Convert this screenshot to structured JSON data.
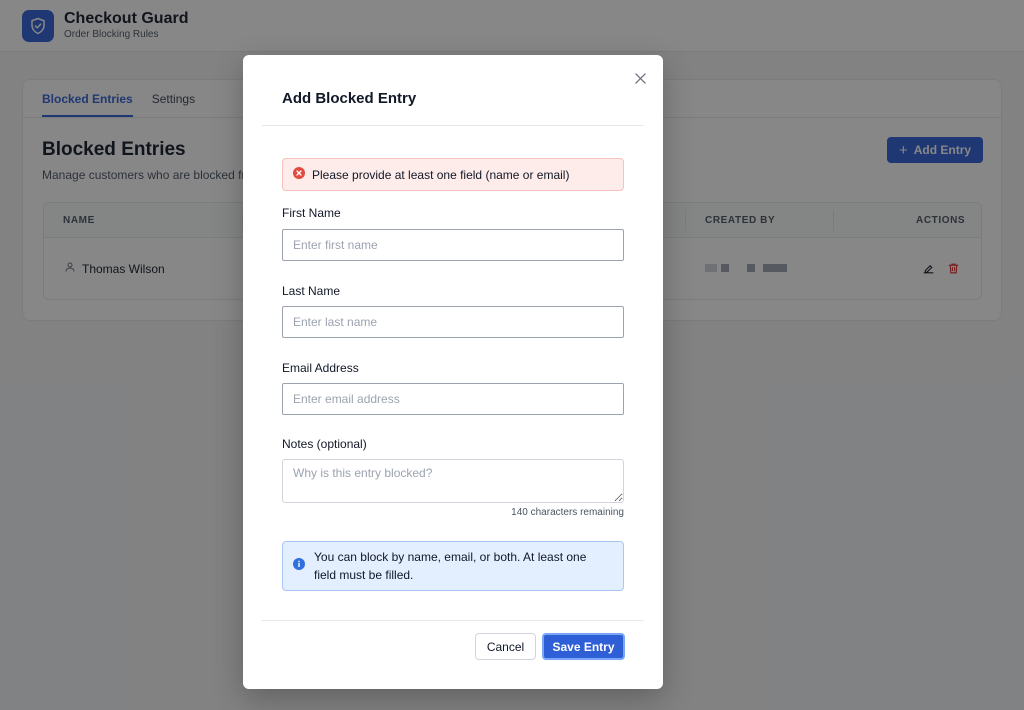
{
  "header": {
    "title": "Checkout Guard",
    "subtitle": "Order Blocking Rules",
    "logo_icon": "shield-check-icon"
  },
  "tabs": [
    {
      "label": "Blocked Entries",
      "active": true
    },
    {
      "label": "Settings",
      "active": false
    }
  ],
  "page": {
    "title": "Blocked Entries",
    "description": "Manage customers who are blocked fro",
    "add_button_label": "Add Entry"
  },
  "table": {
    "columns": [
      "NAME",
      "CREATED BY",
      "ACTIONS"
    ],
    "rows": [
      {
        "name": "Thomas Wilson",
        "created_by": "redacted"
      }
    ]
  },
  "modal": {
    "title": "Add Blocked Entry",
    "error_message": "Please provide at least one field (name or email)",
    "fields": {
      "first_name": {
        "label": "First Name",
        "placeholder": "Enter first name",
        "value": ""
      },
      "last_name": {
        "label": "Last Name",
        "placeholder": "Enter last name",
        "value": ""
      },
      "email": {
        "label": "Email Address",
        "placeholder": "Enter email address",
        "value": ""
      },
      "notes": {
        "label": "Notes (optional)",
        "placeholder": "Why is this entry blocked?",
        "value": ""
      }
    },
    "char_count": "140 characters remaining",
    "info_message": "You can block by name, email, or both. At least one field must be filled.",
    "cancel_label": "Cancel",
    "save_label": "Save Entry"
  },
  "colors": {
    "primary": "#2f5fd7",
    "error_bg": "#fdecea",
    "error_icon": "#e04a3f",
    "info_bg": "#e3efff",
    "info_icon": "#2f6fe0",
    "delete_icon": "#dc2626"
  }
}
